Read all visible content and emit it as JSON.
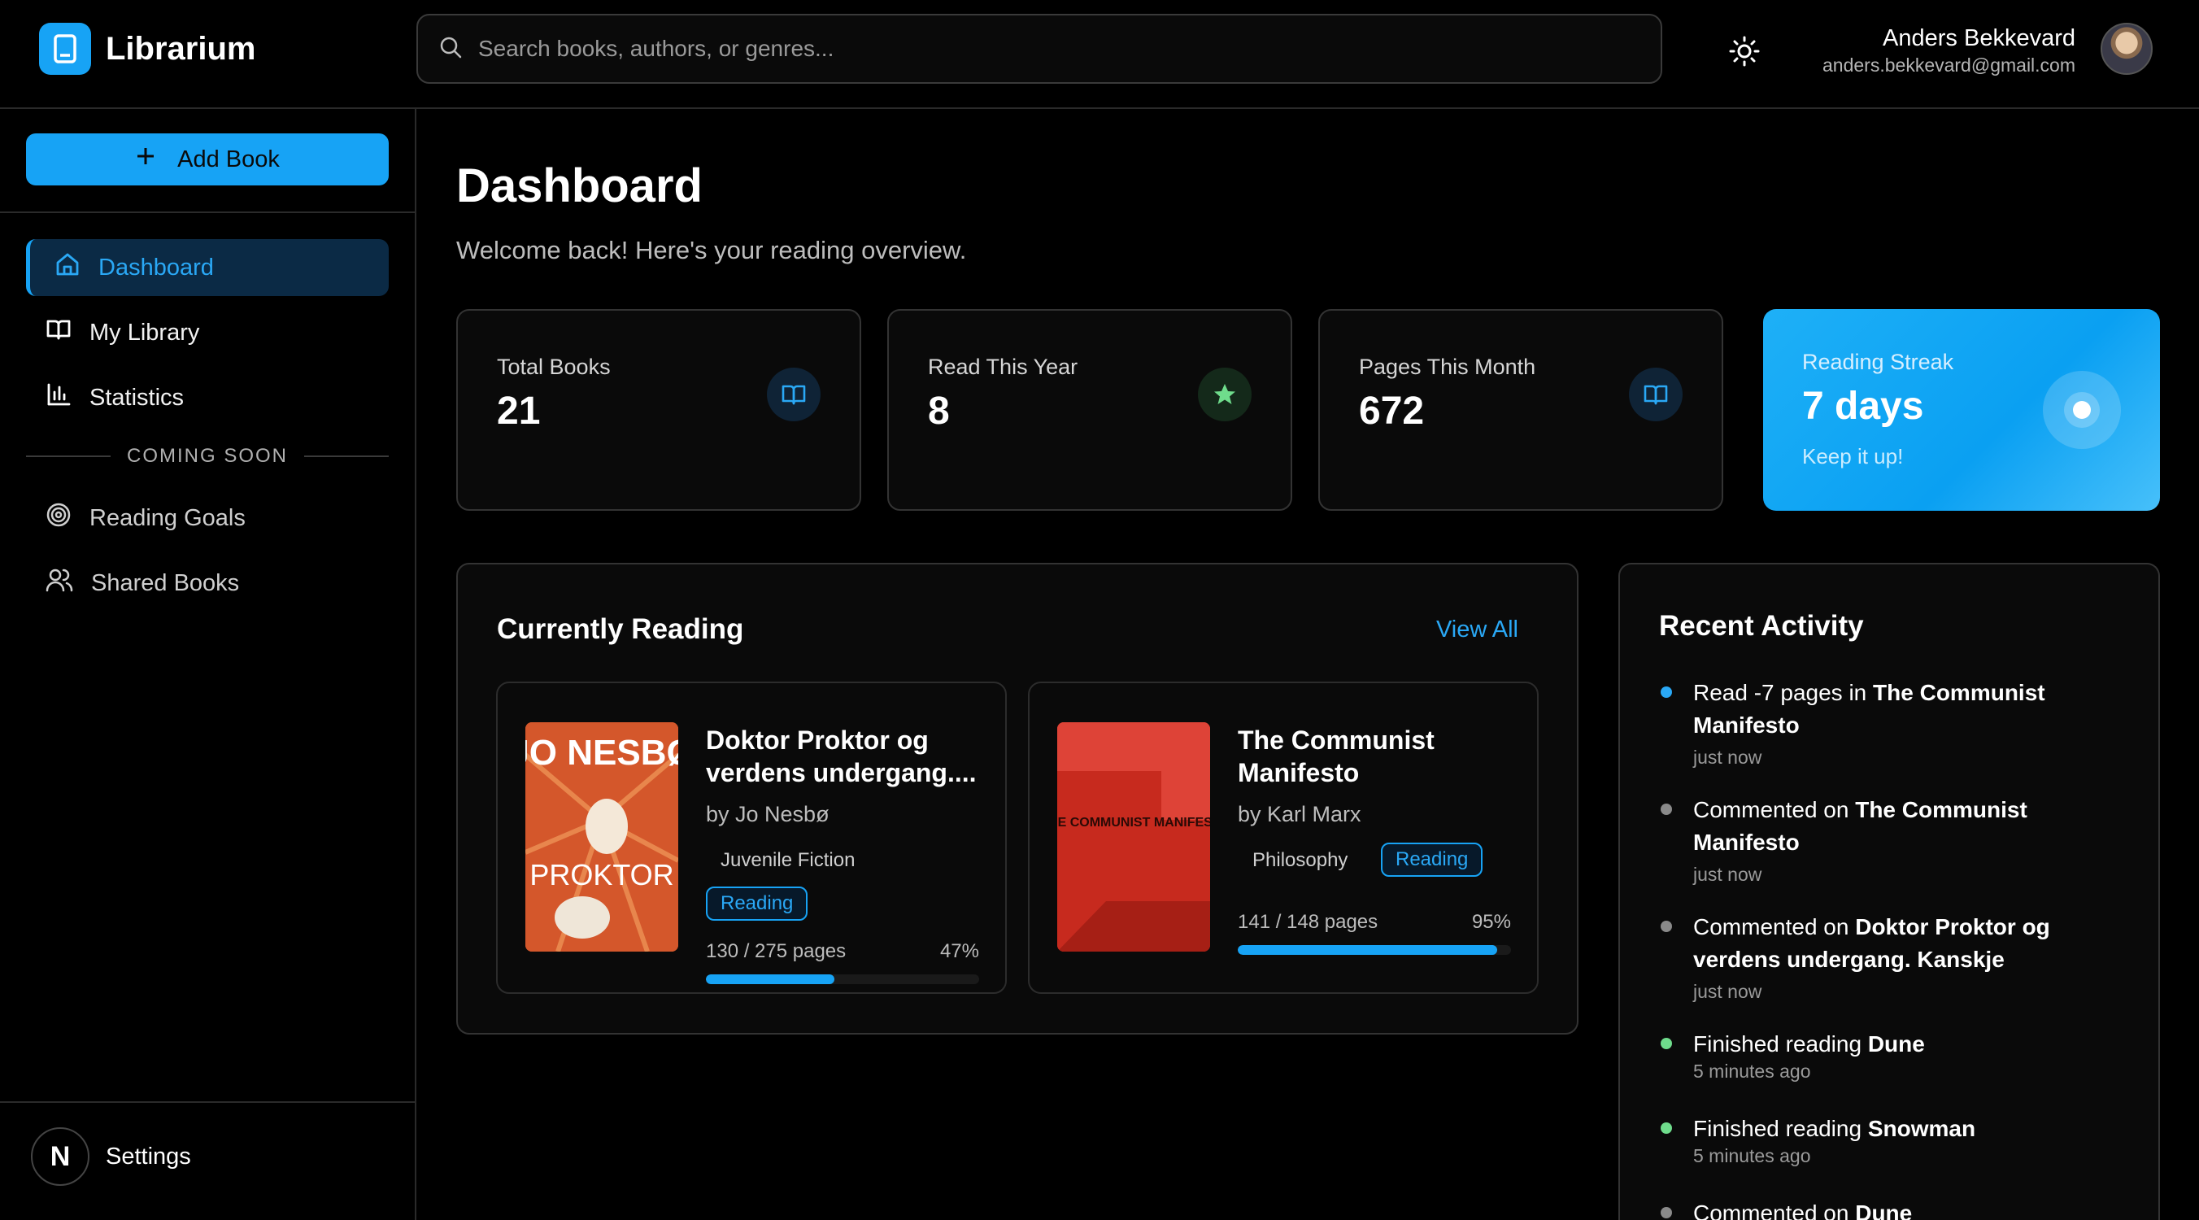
{
  "app": {
    "name": "Librarium"
  },
  "header": {
    "search_placeholder": "Search books, authors, or genres...",
    "user_name": "Anders Bekkevard",
    "user_email": "anders.bekkevard@gmail.com"
  },
  "sidebar": {
    "add_book_label": "Add Book",
    "items": [
      {
        "label": "Dashboard",
        "icon": "home-icon",
        "active": true
      },
      {
        "label": "My Library",
        "icon": "book-open-icon"
      },
      {
        "label": "Statistics",
        "icon": "bar-chart-icon"
      }
    ],
    "coming_soon_label": "COMING SOON",
    "soon_items": [
      {
        "label": "Reading Goals",
        "icon": "target-icon"
      },
      {
        "label": "Shared Books",
        "icon": "users-icon"
      }
    ],
    "settings_label": "Settings",
    "settings_badge": "N"
  },
  "main": {
    "title": "Dashboard",
    "subtitle": "Welcome back! Here's your reading overview.",
    "stats": [
      {
        "label": "Total Books",
        "value": "21",
        "icon": "book-open-icon"
      },
      {
        "label": "Read This Year",
        "value": "8",
        "icon": "star-icon"
      },
      {
        "label": "Pages This Month",
        "value": "672",
        "icon": "book-open-icon"
      }
    ],
    "streak": {
      "label": "Reading Streak",
      "value": "7 days",
      "note": "Keep it up!"
    },
    "currently_reading": {
      "title": "Currently Reading",
      "view_all": "View All",
      "books": [
        {
          "title": "Doktor Proktor og verdens undergang....",
          "author": "by Jo Nesbø",
          "genre": "Juvenile Fiction",
          "status": "Reading",
          "pages": "130 / 275 pages",
          "percent_label": "47%",
          "progress": 0.47,
          "cover_author": "JO NESBØ",
          "cover_title": "PROKTOR"
        },
        {
          "title": "The Communist Manifesto",
          "author": "by Karl Marx",
          "genre": "Philosophy",
          "status": "Reading",
          "pages": "141 / 148 pages",
          "percent_label": "95%",
          "progress": 0.95,
          "cover_title": "THE COMMUNIST MANIFESTO"
        }
      ]
    },
    "recent_activity": {
      "title": "Recent Activity",
      "items": [
        {
          "prefix": "Read -7 pages in ",
          "bold": "The Communist Manifesto",
          "time": "just now",
          "color": "#2aa8f5"
        },
        {
          "prefix": "Commented on ",
          "bold": "The Communist Manifesto",
          "time": "just now",
          "color": "#8a8a8a"
        },
        {
          "prefix": "Commented on ",
          "bold": "Doktor Proktor og verdens undergang. Kanskje",
          "time": "just now",
          "color": "#8a8a8a"
        },
        {
          "prefix": "Finished reading ",
          "bold": "Dune",
          "time": "5 minutes ago",
          "color": "#6fdc8c"
        },
        {
          "prefix": "Finished reading ",
          "bold": "Snowman",
          "time": "5 minutes ago",
          "color": "#6fdc8c"
        },
        {
          "prefix": "Commented on ",
          "bold": "Dune",
          "time": "",
          "color": "#8a8a8a"
        }
      ]
    }
  }
}
